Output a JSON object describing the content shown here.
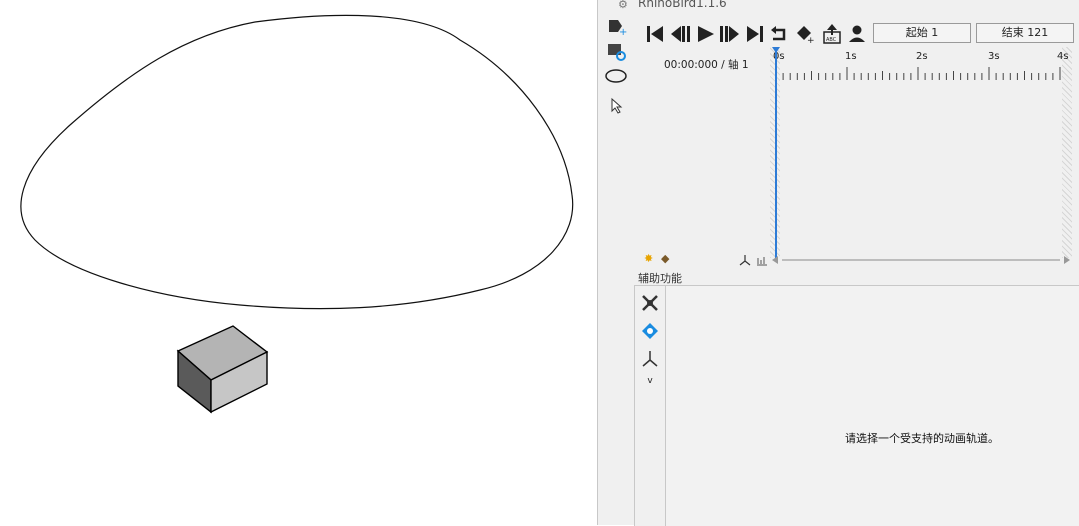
{
  "panel": {
    "title": "RhinoBird1.1.6",
    "start_field": "起始 1",
    "end_field": "结束 121",
    "timecode": "00:00:000 / 轴 1",
    "ticks": [
      "0s",
      "1s",
      "2s",
      "3s",
      "4s"
    ],
    "aux_label": "辅助功能",
    "aux_message": "请选择一个受支持的动画轨道。",
    "aux_expand": "v"
  },
  "icons": {
    "left_tools": [
      "add-track-icon",
      "refresh-track-icon",
      "ellipse-icon",
      "cursor-icon"
    ],
    "transport": [
      "skip-to-start-icon",
      "step-back-icon",
      "play-icon",
      "step-forward-icon",
      "skip-to-end-icon",
      "loop-icon",
      "add-keyframe-icon",
      "export-icon",
      "user-icon"
    ],
    "aux_tools": [
      "tools-icon",
      "orient-icon",
      "axis-icon"
    ]
  },
  "colors": {
    "playhead": "#2d7bd6",
    "accent": "#1a8ce0",
    "panel_bg": "#f0f0f0"
  }
}
